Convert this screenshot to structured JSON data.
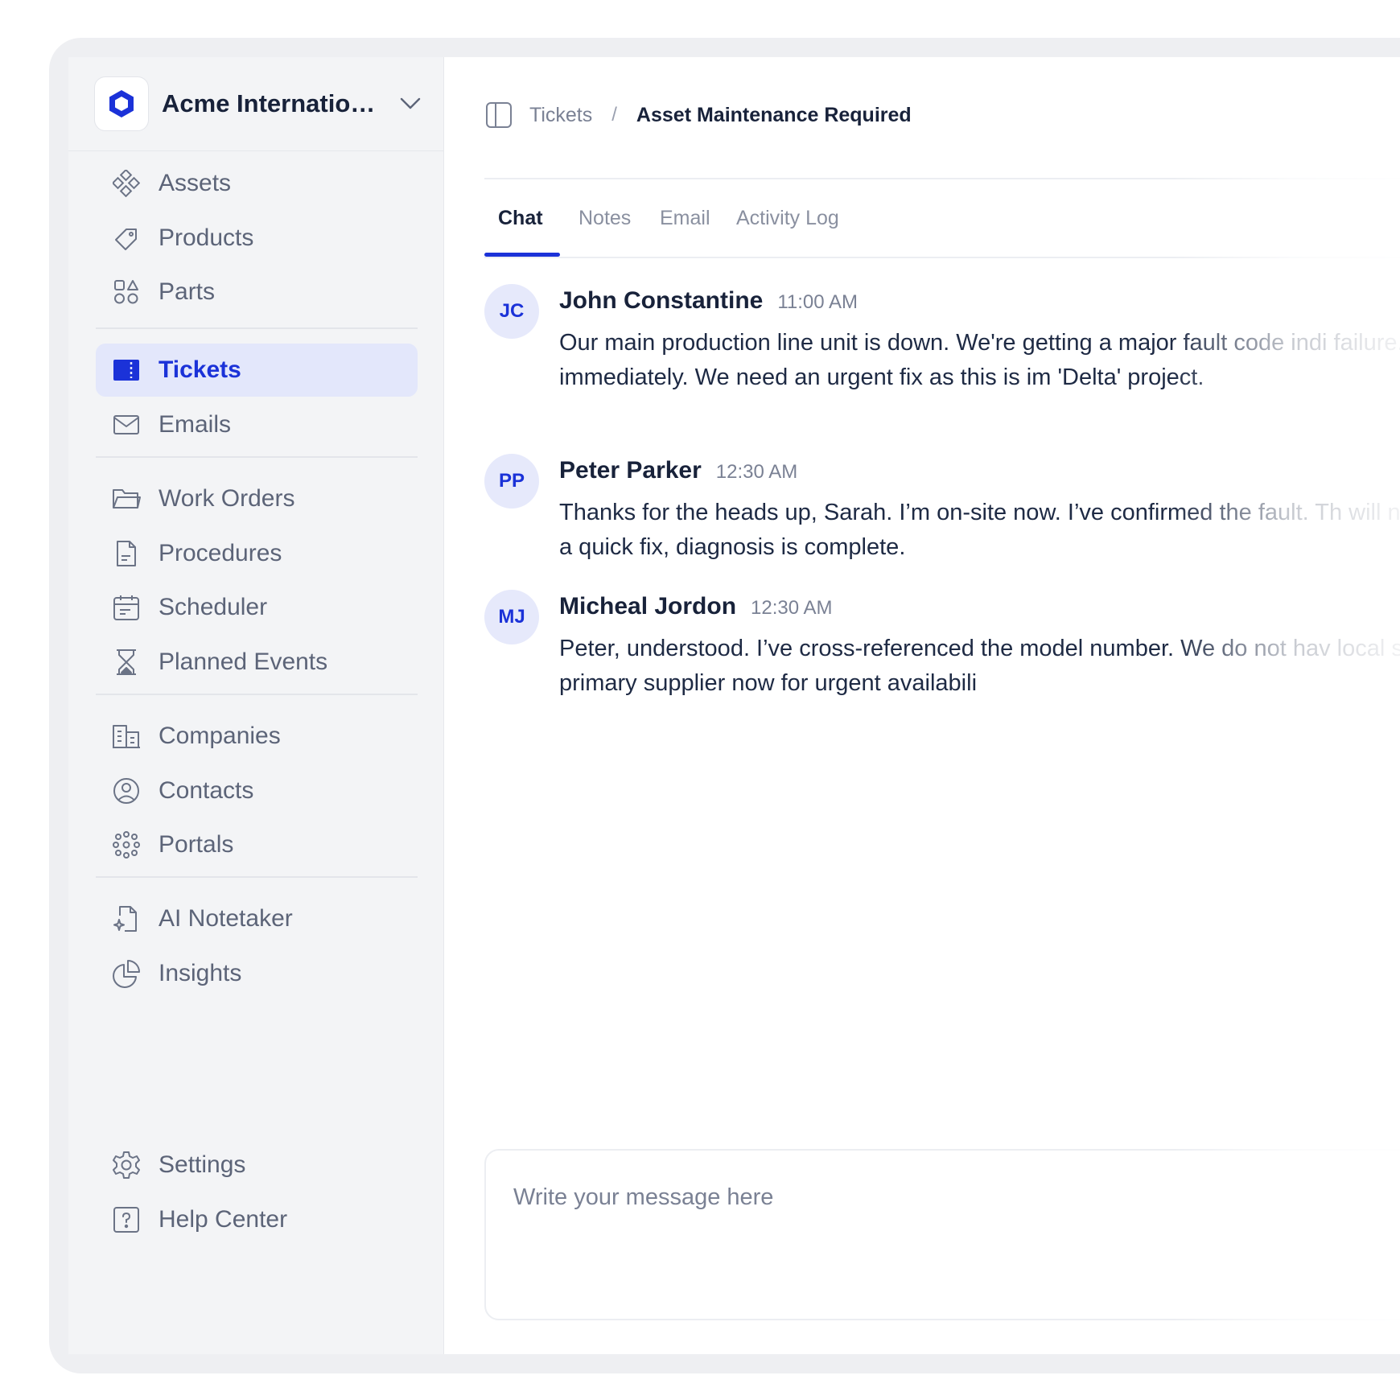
{
  "org": {
    "name": "Acme International",
    "display_name": "Acme Internation..."
  },
  "colors": {
    "accent": "#1b32d8",
    "active_bg": "#e3e7fb",
    "sidebar_bg": "#f3f4f6"
  },
  "sidebar": {
    "groups": [
      [
        {
          "label": "Assets",
          "icon": "assets-icon"
        },
        {
          "label": "Products",
          "icon": "tag-icon"
        },
        {
          "label": "Parts",
          "icon": "shapes-icon"
        }
      ],
      [
        {
          "label": "Tickets",
          "icon": "ticket-icon",
          "active": true
        },
        {
          "label": "Emails",
          "icon": "mail-icon"
        }
      ],
      [
        {
          "label": "Work Orders",
          "icon": "folder-icon"
        },
        {
          "label": "Procedures",
          "icon": "document-icon"
        },
        {
          "label": "Scheduler",
          "icon": "calendar-icon"
        },
        {
          "label": "Planned Events",
          "icon": "hourglass-icon"
        }
      ],
      [
        {
          "label": "Companies",
          "icon": "building-icon"
        },
        {
          "label": "Contacts",
          "icon": "user-circle-icon"
        },
        {
          "label": "Portals",
          "icon": "network-icon"
        }
      ],
      [
        {
          "label": "AI Notetaker",
          "icon": "ai-file-icon"
        },
        {
          "label": "Insights",
          "icon": "pie-chart-icon"
        }
      ]
    ],
    "footer": [
      {
        "label": "Settings",
        "icon": "gear-icon"
      },
      {
        "label": "Help Center",
        "icon": "help-icon"
      }
    ]
  },
  "breadcrumb": {
    "parent": "Tickets",
    "separator": "/",
    "current": "Asset Maintenance Required"
  },
  "tabs": [
    {
      "label": "Chat",
      "active": true
    },
    {
      "label": "Notes"
    },
    {
      "label": "Email"
    },
    {
      "label": "Activity Log"
    }
  ],
  "messages": [
    {
      "initials": "JC",
      "name": "John Constantine",
      "time": "11:00 AM",
      "text": "Our main production line unit is down. We're getting a major fault code indi failure. We stopped the line immediately. We need an urgent fix as this is im 'Delta' project."
    },
    {
      "initials": "PP",
      "name": "Peter Parker",
      "time": "12:30 AM",
      "text": "Thanks for the heads up, Sarah. I’m on-site now. I’ve confirmed the fault. Th will need replacement. This isn’t a quick fix, diagnosis is complete."
    },
    {
      "initials": "MJ",
      "name": "Micheal Jordon",
      "time": "12:30 AM",
      "text": "Peter, understood. I’ve cross-referenced the model number. We do not hav local stock. I’m checking with our primary supplier now for urgent availabili"
    }
  ],
  "composer": {
    "placeholder": "Write your message here",
    "value": ""
  }
}
